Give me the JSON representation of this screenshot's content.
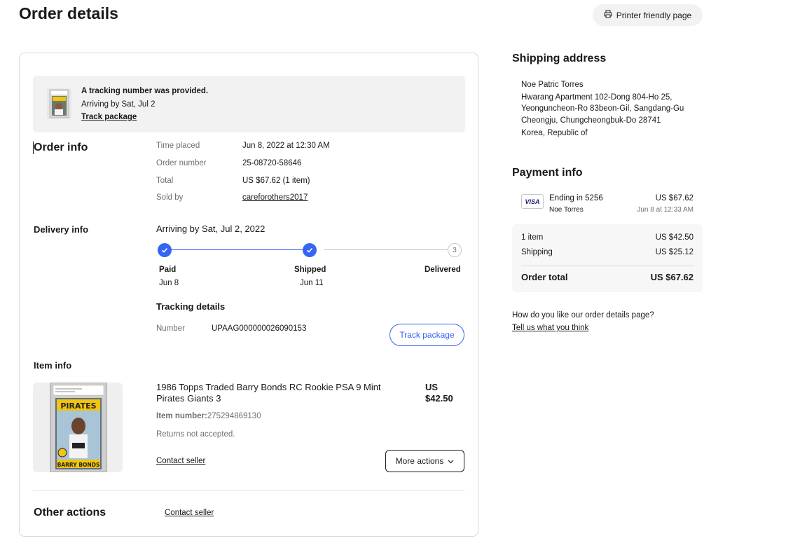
{
  "header": {
    "title": "Order details",
    "printer_label": "Printer friendly page"
  },
  "banner": {
    "title": "A tracking number was provided.",
    "arriving": "Arriving by Sat, Jul 2",
    "link": "Track package"
  },
  "order_info": {
    "title": "Order info",
    "rows": [
      {
        "label": "Time placed",
        "value": "Jun 8, 2022 at 12:30 AM"
      },
      {
        "label": "Order number",
        "value": "25-08720-58646"
      },
      {
        "label": "Total",
        "value": "US $67.62 (1 item)"
      },
      {
        "label": "Sold by",
        "value": "careforothers2017"
      }
    ]
  },
  "delivery": {
    "title": "Delivery info",
    "arriving": "Arriving by Sat, Jul 2, 2022",
    "steps": [
      {
        "label": "Paid",
        "date": "Jun 8",
        "done": true
      },
      {
        "label": "Shipped",
        "date": "Jun 11",
        "done": true
      },
      {
        "label": "Delivered",
        "date": "",
        "done": false,
        "number": "3"
      }
    ],
    "tracking_title": "Tracking details",
    "number_label": "Number",
    "number_value": "UPAAG000000026090153",
    "track_button": "Track package"
  },
  "item": {
    "section_title": "Item info",
    "title": "1986 Topps Traded Barry Bonds RC Rookie PSA 9 Mint Pirates Giants 3",
    "price_currency": "US",
    "price_amount": "$42.50",
    "number_label": "Item number:",
    "number_value": "275294869130",
    "returns": "Returns not accepted.",
    "contact_seller": "Contact seller",
    "more_actions": "More actions",
    "card_brand": "PIRATES",
    "card_player": "BARRY BONDS"
  },
  "other_actions": {
    "title": "Other actions",
    "contact_seller": "Contact seller"
  },
  "shipping": {
    "title": "Shipping address",
    "lines": [
      "Noe Patric Torres",
      "Hwarang Apartment 102-Dong 804-Ho 25,",
      "Yeonguncheon-Ro 83beon-Gil, Sangdang-Gu",
      "Cheongju, Chungcheongbuk-Do 28741",
      "Korea, Republic of"
    ]
  },
  "payment": {
    "title": "Payment info",
    "card_logo": "VISA",
    "ending": "Ending in 5256",
    "name": "Noe Torres",
    "amount": "US $67.62",
    "date": "Jun 8 at 12:33 AM",
    "items_label": "1 item",
    "items_value": "US $42.50",
    "shipping_label": "Shipping",
    "shipping_value": "US $25.12",
    "total_label": "Order total",
    "total_value": "US $67.62"
  },
  "feedback": {
    "question": "How do you like our order details page?",
    "link": "Tell us what you think"
  },
  "colors": {
    "accent": "#3665f3",
    "text": "#191919",
    "muted": "#707070",
    "panel": "#f2f2f2"
  }
}
